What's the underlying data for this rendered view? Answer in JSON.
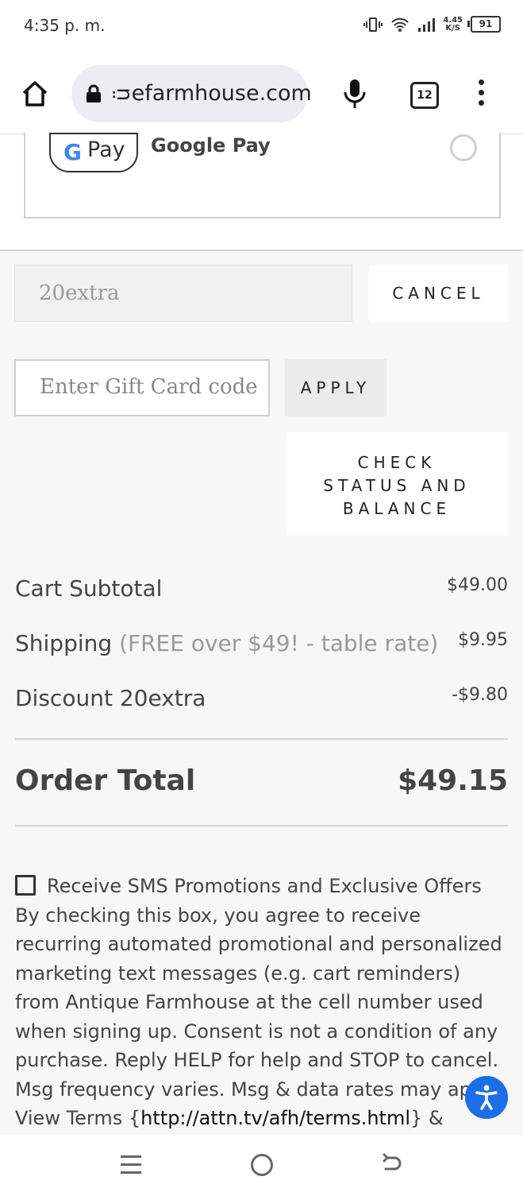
{
  "status_bar": {
    "time": "4:35 p. m.",
    "net_speed_value": "4.45",
    "net_speed_unit": "K/S",
    "battery": "91"
  },
  "browser": {
    "url": "ᴞefarmhouse.com",
    "tab_count": "12"
  },
  "payment_method": {
    "badge_g": "G",
    "badge_pay": "Pay",
    "label": "Google Pay"
  },
  "coupon": {
    "value": "20extra",
    "cancel_label": "CANCEL"
  },
  "gift_card": {
    "placeholder": "Enter Gift Card code",
    "apply_label": "APPLY",
    "check_label_lines": [
      "CHECK",
      "STATUS AND",
      "BALANCE"
    ]
  },
  "totals": {
    "subtotal_label": "Cart Subtotal",
    "subtotal_value": "$49.00",
    "shipping_label": "Shipping",
    "shipping_note": "(FREE over $49! - table rate)",
    "shipping_value": "$9.95",
    "discount_label": "Discount 20extra",
    "discount_value": "-$9.80",
    "order_total_label": "Order Total",
    "order_total_value": "$49.15"
  },
  "sms": {
    "checkbox_label": "Receive SMS Promotions and Exclusive Offers",
    "body": "By checking this box, you agree to receive recurring automated promotional and personalized marketing text messages (e.g. cart reminders) from Antique Farmhouse at the cell number used when signing up. Consent is not a condition of any purchase. Reply HELP for help and STOP to cancel. Msg frequency varies. Msg & data rates may app",
    "terms_prefix": "View Terms {",
    "terms_link": "http://attn.tv/afh/terms.html",
    "terms_suffix": "} & Privacy"
  },
  "colors": {
    "accessibility_button": "#1a6fe6",
    "page_background": "#f7f7f7"
  }
}
